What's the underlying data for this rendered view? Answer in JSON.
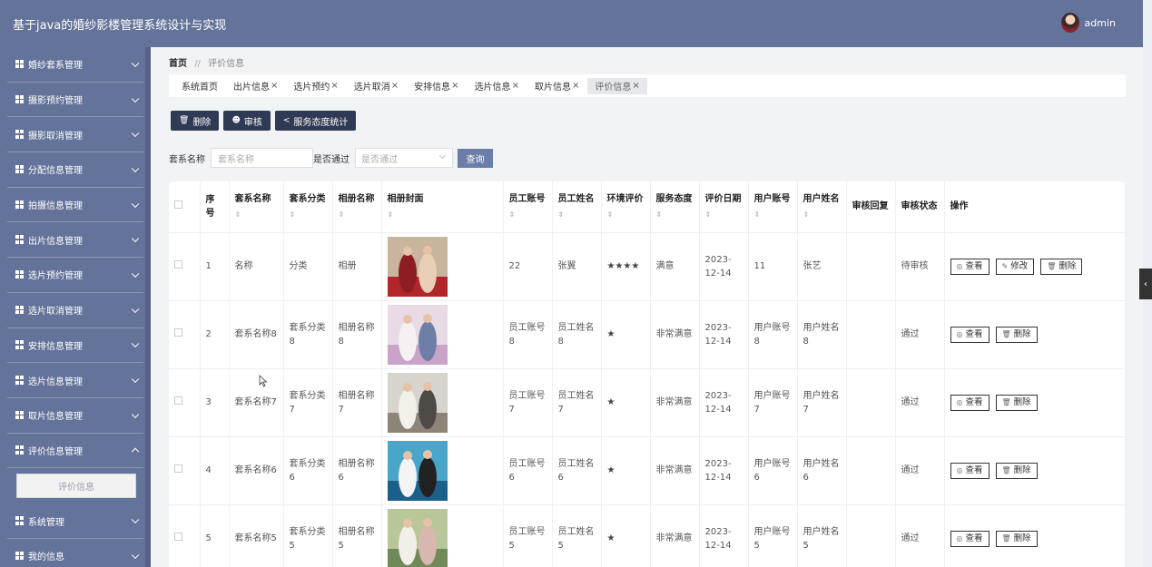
{
  "header": {
    "title": "基于java的婚纱影楼管理系统设计与实现",
    "username": "admin"
  },
  "sidebar": {
    "items": [
      {
        "label": "婚纱套系管理",
        "icon": "chart-icon"
      },
      {
        "label": "摄影预约管理",
        "icon": "grid-icon"
      },
      {
        "label": "摄影取消管理",
        "icon": "comment-icon"
      },
      {
        "label": "分配信息管理",
        "icon": "bar-chart-icon"
      },
      {
        "label": "拍摄信息管理",
        "icon": "sliders-icon"
      },
      {
        "label": "出片信息管理",
        "icon": "pin-icon"
      },
      {
        "label": "选片预约管理",
        "icon": "grid-icon"
      },
      {
        "label": "选片取消管理",
        "icon": "grid-icon"
      },
      {
        "label": "安排信息管理",
        "icon": "check-square-icon"
      },
      {
        "label": "选片信息管理",
        "icon": "table-icon"
      },
      {
        "label": "取片信息管理",
        "icon": "list-icon"
      },
      {
        "label": "评价信息管理",
        "icon": "grid-icon",
        "expanded": true
      }
    ],
    "sub_item": "评价信息",
    "items_after": [
      {
        "label": "系统管理",
        "icon": "grid-icon"
      },
      {
        "label": "我的信息",
        "icon": "id-card-icon"
      }
    ]
  },
  "breadcrumb": {
    "home": "首页",
    "sep": "//",
    "current": "评价信息"
  },
  "tabs": [
    {
      "label": "系统首页",
      "closable": false
    },
    {
      "label": "出片信息",
      "closable": true
    },
    {
      "label": "选片预约",
      "closable": true
    },
    {
      "label": "选片取消",
      "closable": true
    },
    {
      "label": "安排信息",
      "closable": true
    },
    {
      "label": "选片信息",
      "closable": true
    },
    {
      "label": "取片信息",
      "closable": true
    },
    {
      "label": "评价信息",
      "closable": true,
      "active": true
    }
  ],
  "toolbar": {
    "delete": "删除",
    "audit": "审核",
    "stats": "服务态度统计"
  },
  "search": {
    "name_label": "套系名称",
    "name_placeholder": "套系名称",
    "pass_label": "是否通过",
    "pass_placeholder": "是否通过",
    "query": "查询"
  },
  "table": {
    "columns": [
      "序号",
      "套系名称",
      "套系分类",
      "相册名称",
      "相册封面",
      "员工账号",
      "员工姓名",
      "环境评价",
      "服务态度",
      "评价日期",
      "用户账号",
      "用户姓名",
      "审核回复",
      "审核状态",
      "操作"
    ],
    "sortable": [
      false,
      true,
      true,
      true,
      true,
      true,
      true,
      true,
      true,
      true,
      true,
      true,
      false,
      false,
      false
    ],
    "rows": [
      {
        "no": "1",
        "name": "名称",
        "cat": "分类",
        "album": "相册",
        "emp_acc": "22",
        "emp_name": "张翼",
        "env": "★★★★",
        "service": "满意",
        "date": "2023-12-14",
        "user_acc": "11",
        "user_name": "张艺",
        "reply": "",
        "status": "待审核",
        "ops": [
          "查看",
          "修改",
          "删除"
        ],
        "photo": "red"
      },
      {
        "no": "2",
        "name": "套系名称8",
        "cat": "套系分类8",
        "album": "相册名称8",
        "emp_acc": "员工账号8",
        "emp_name": "员工姓名8",
        "env": "★",
        "service": "非常满意",
        "date": "2023-12-14",
        "user_acc": "用户账号8",
        "user_name": "用户姓名8",
        "reply": "",
        "status": "通过",
        "ops": [
          "查看",
          "删除"
        ],
        "photo": "pink"
      },
      {
        "no": "3",
        "name": "套系名称7",
        "cat": "套系分类7",
        "album": "相册名称7",
        "emp_acc": "员工账号7",
        "emp_name": "员工姓名7",
        "env": "★",
        "service": "非常满意",
        "date": "2023-12-14",
        "user_acc": "用户账号7",
        "user_name": "用户姓名7",
        "reply": "",
        "status": "通过",
        "ops": [
          "查看",
          "删除"
        ],
        "photo": "grey"
      },
      {
        "no": "4",
        "name": "套系名称6",
        "cat": "套系分类6",
        "album": "相册名称6",
        "emp_acc": "员工账号6",
        "emp_name": "员工姓名6",
        "env": "★",
        "service": "非常满意",
        "date": "2023-12-14",
        "user_acc": "用户账号6",
        "user_name": "用户姓名6",
        "reply": "",
        "status": "通过",
        "ops": [
          "查看",
          "删除"
        ],
        "photo": "blue"
      },
      {
        "no": "5",
        "name": "套系名称5",
        "cat": "套系分类5",
        "album": "相册名称5",
        "emp_acc": "员工账号5",
        "emp_name": "员工姓名5",
        "env": "★",
        "service": "非常满意",
        "date": "2023-12-14",
        "user_acc": "用户账号5",
        "user_name": "用户姓名5",
        "reply": "",
        "status": "通过",
        "ops": [
          "查看",
          "删除"
        ],
        "photo": "green"
      }
    ]
  },
  "colors": {
    "header": "#64739a",
    "sidebar": "#64739a",
    "button": "#2f3a55",
    "query": "#6b7ea8"
  }
}
